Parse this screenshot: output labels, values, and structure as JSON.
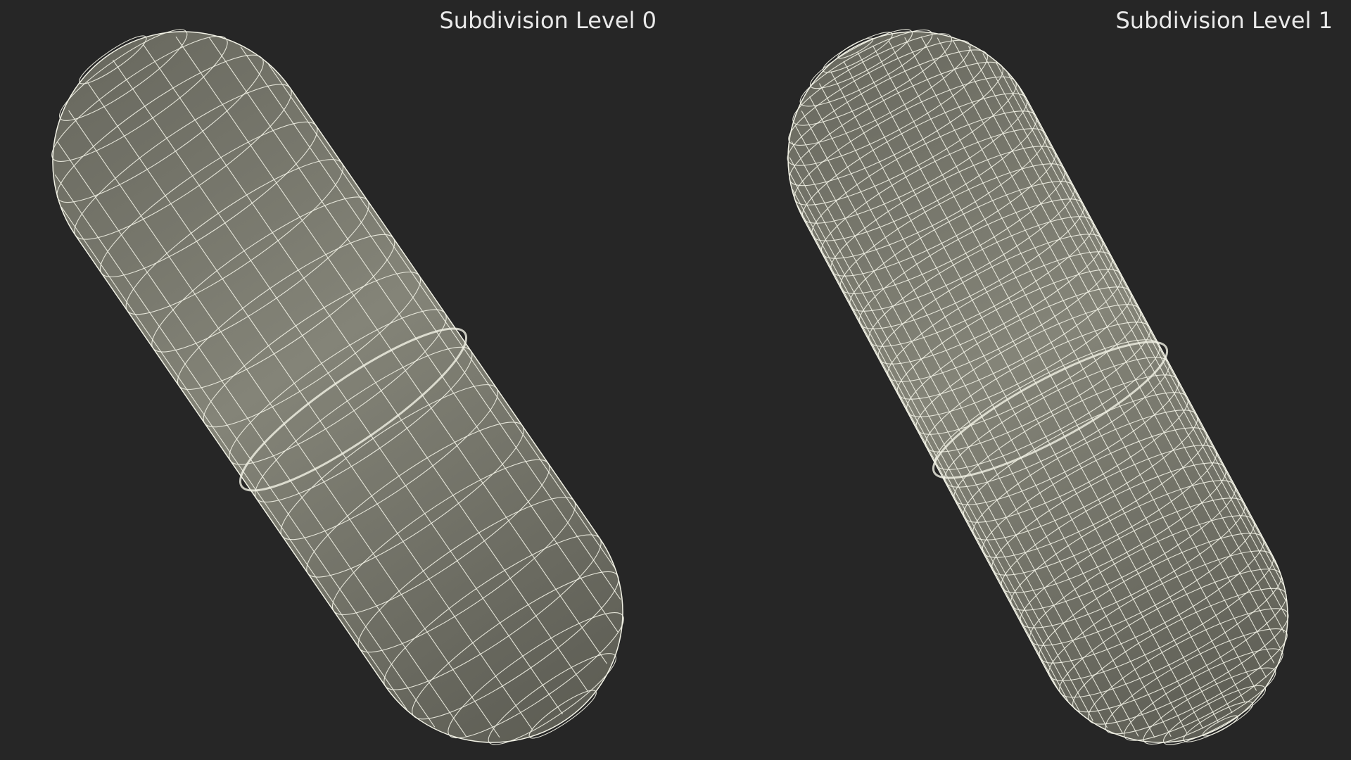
{
  "labels": {
    "left": "Subdivision Level 0",
    "right": "Subdivision Level 1"
  },
  "colors": {
    "background": "#262626",
    "label_text": "#e9e9e9",
    "mesh_fill": "#7e7e72",
    "mesh_shade": "#5e5e55",
    "wire": "#f2f2e6"
  }
}
